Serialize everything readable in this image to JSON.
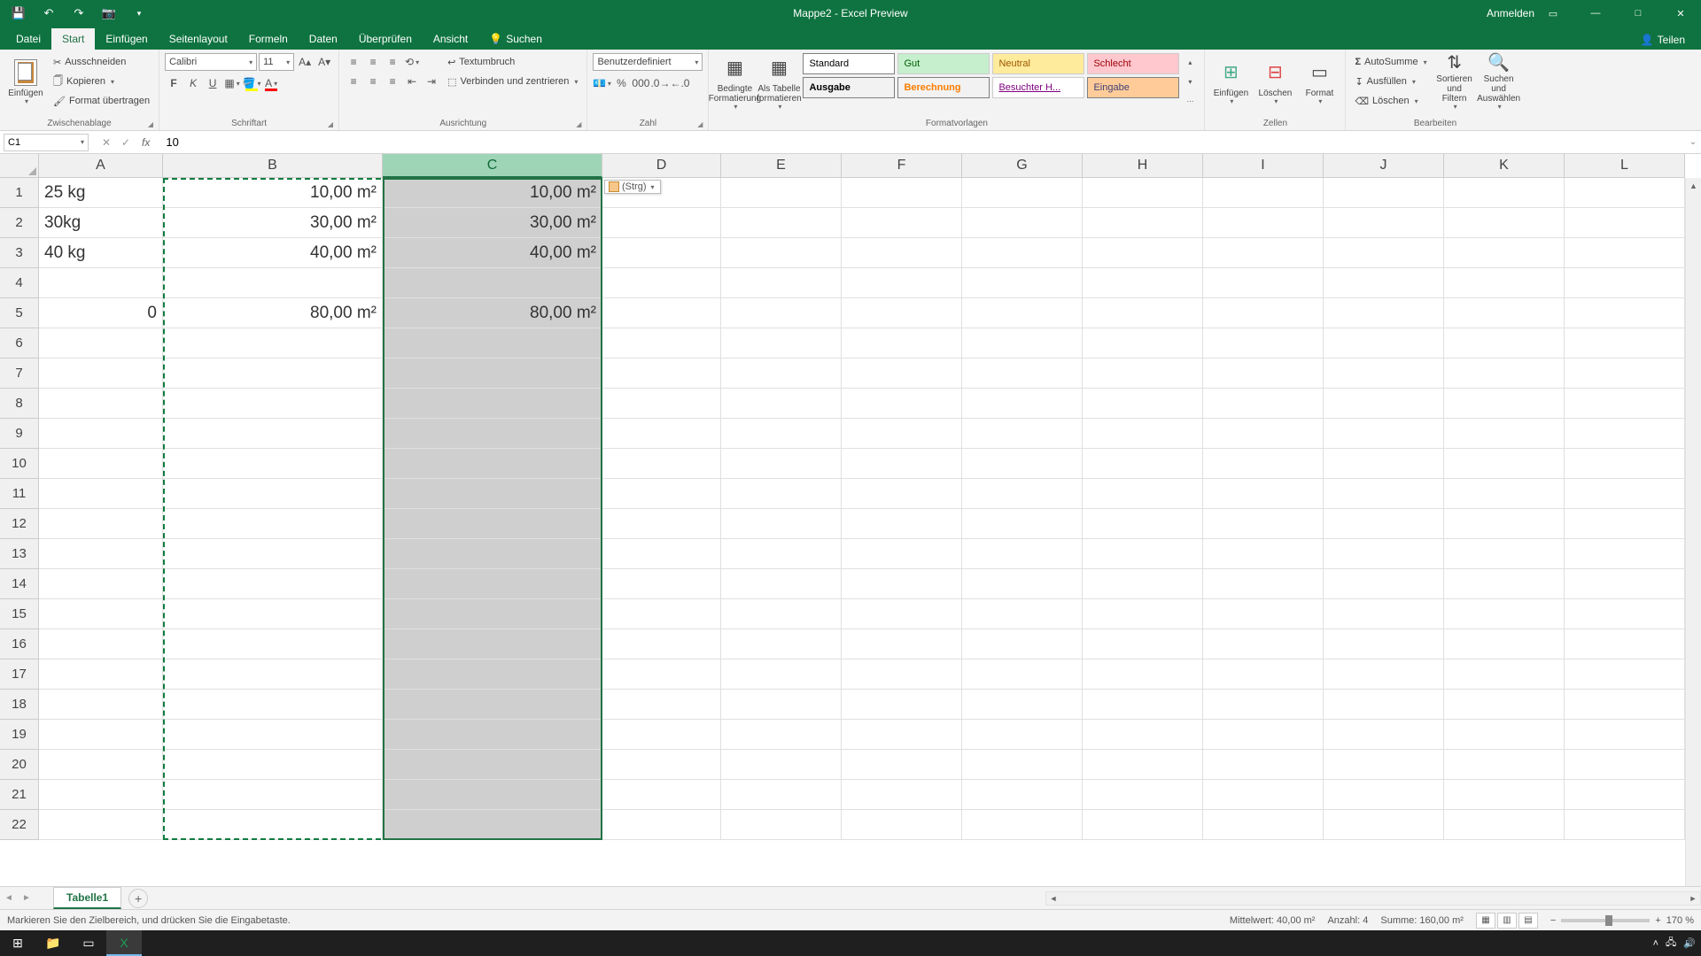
{
  "title": "Mappe2  -  Excel Preview",
  "titlebar": {
    "signin": "Anmelden"
  },
  "tabs": {
    "file": "Datei",
    "items": [
      "Start",
      "Einfügen",
      "Seitenlayout",
      "Formeln",
      "Daten",
      "Überprüfen",
      "Ansicht"
    ],
    "active_index": 0,
    "search": "Suchen",
    "share": "Teilen"
  },
  "ribbon": {
    "clipboard": {
      "paste": "Einfügen",
      "cut": "Ausschneiden",
      "copy": "Kopieren",
      "format_painter": "Format übertragen",
      "label": "Zwischenablage"
    },
    "font": {
      "name": "Calibri",
      "size": "11",
      "label": "Schriftart"
    },
    "alignment": {
      "wrap": "Textumbruch",
      "merge": "Verbinden und zentrieren",
      "label": "Ausrichtung"
    },
    "number": {
      "format": "Benutzerdefiniert",
      "label": "Zahl"
    },
    "styles": {
      "cond": "Bedingte Formatierung",
      "table": "Als Tabelle formatieren",
      "label": "Formatvorlagen",
      "cells": [
        "Standard",
        "Gut",
        "Neutral",
        "Schlecht",
        "Ausgabe",
        "Berechnung",
        "Besuchter H...",
        "Eingabe"
      ]
    },
    "cells_group": {
      "insert": "Einfügen",
      "delete": "Löschen",
      "format": "Format",
      "label": "Zellen"
    },
    "editing": {
      "autosum": "AutoSumme",
      "fill": "Ausfüllen",
      "clear": "Löschen",
      "sort": "Sortieren und Filtern",
      "find": "Suchen und Auswählen",
      "label": "Bearbeiten"
    }
  },
  "formula_bar": {
    "name_box": "C1",
    "value": "10"
  },
  "grid": {
    "col_widths": {
      "A": 140,
      "B": 248,
      "C": 248,
      "D": 134,
      "E": 136,
      "F": 136,
      "G": 136,
      "H": 136,
      "I": 136,
      "J": 136,
      "K": 136,
      "L": 136
    },
    "columns": [
      "A",
      "B",
      "C",
      "D",
      "E",
      "F",
      "G",
      "H",
      "I",
      "J",
      "K",
      "L"
    ],
    "selected_col": "C",
    "copy_range_cols": [
      "B",
      "C"
    ],
    "rows_visible": 22,
    "cells": {
      "A1": "25 kg",
      "B1": "10,00 m²",
      "C1": "10,00 m²",
      "A2": "30kg",
      "B2": "30,00 m²",
      "C2": "30,00 m²",
      "A3": "40 kg",
      "B3": "40,00 m²",
      "C3": "40,00 m²",
      "A5": "0",
      "B5": "80,00 m²",
      "C5": "80,00 m²"
    },
    "paste_tag": "(Strg)"
  },
  "sheet_tabs": {
    "active": "Tabelle1"
  },
  "status": {
    "left": "Markieren Sie den Zielbereich, und drücken Sie die Eingabetaste.",
    "avg_label": "Mittelwert:",
    "avg": "40,00 m²",
    "count_label": "Anzahl:",
    "count": "4",
    "sum_label": "Summe:",
    "sum": "160,00 m²",
    "zoom": "170 %"
  }
}
